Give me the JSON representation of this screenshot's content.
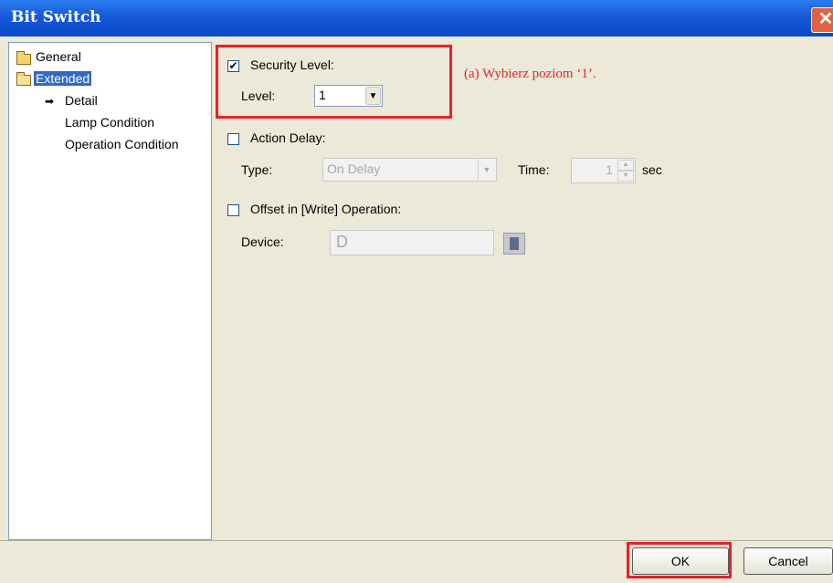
{
  "window": {
    "title": "Bit Switch"
  },
  "tree": {
    "items": [
      {
        "label": "General"
      },
      {
        "label": "Extended"
      },
      {
        "label": "Detail"
      },
      {
        "label": "Lamp Condition"
      },
      {
        "label": "Operation Condition"
      }
    ]
  },
  "security": {
    "checkbox_label": "Security Level:",
    "checked": true,
    "level_label": "Level:",
    "level_value": "1"
  },
  "action_delay": {
    "checkbox_label": "Action Delay:",
    "checked": false,
    "type_label": "Type:",
    "type_value": "On Delay",
    "time_label": "Time:",
    "time_value": "1",
    "time_unit": "sec"
  },
  "offset": {
    "checkbox_label": "Offset in [Write] Operation:",
    "checked": false,
    "device_label": "Device:",
    "device_value": "D"
  },
  "annotation": "(a) Wybierz poziom ‘1’.",
  "buttons": {
    "ok": "OK",
    "cancel": "Cancel"
  },
  "colors": {
    "highlight": "#e8202a",
    "title_bar": "#0a49c8",
    "selection": "#316ac5"
  }
}
